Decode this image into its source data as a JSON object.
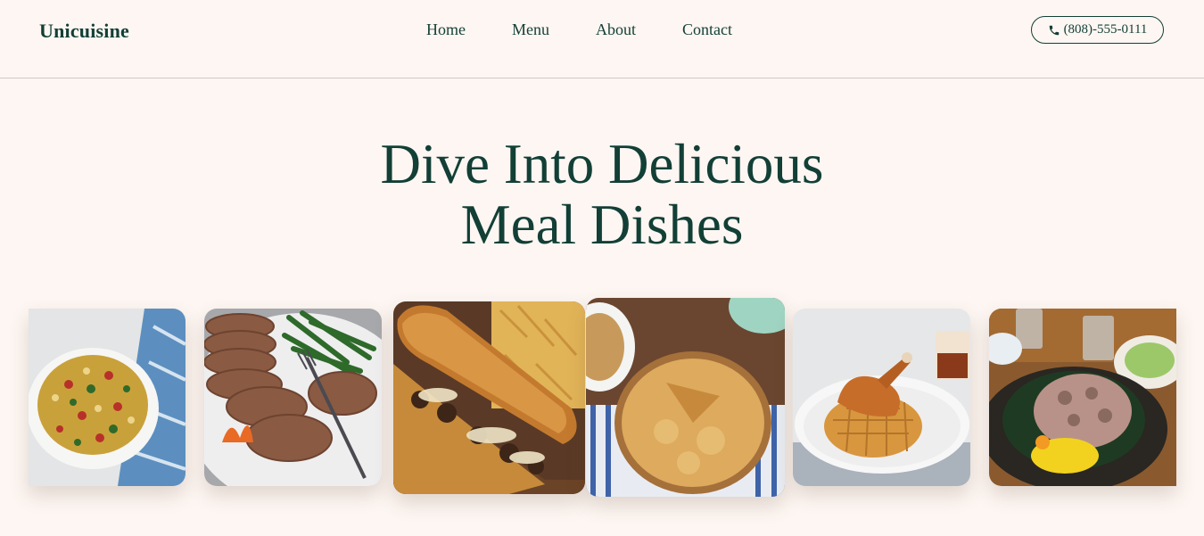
{
  "brand": {
    "name": "Unicuisine"
  },
  "nav": {
    "links": [
      "Home",
      "Menu",
      "About",
      "Contact"
    ]
  },
  "contact": {
    "phone": "(808)-555-0111",
    "icon": "phone-icon"
  },
  "hero": {
    "line1": "Dive Into Delicious",
    "line2": "Meal Dishes"
  },
  "gallery": {
    "dishes": [
      "corn-salad-bowl-image",
      "meatloaf-green-beans-image",
      "cheesesteak-fries-image",
      "apple-pie-image",
      "chicken-waffle-image",
      "sizzling-plate-image"
    ]
  },
  "colors": {
    "brand": "#123f36",
    "background": "#fdf6f2"
  }
}
